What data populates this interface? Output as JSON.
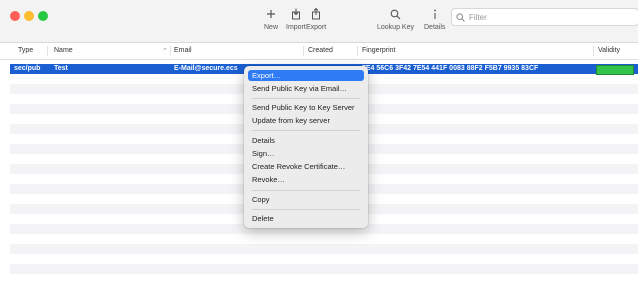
{
  "toolbar": {
    "new_label": "New",
    "import_label": "Import",
    "export_label": "Export",
    "lookup_label": "Lookup Key",
    "details_label": "Details",
    "search_placeholder": "Filter"
  },
  "table": {
    "columns": [
      "Type",
      "Name",
      "Email",
      "Created",
      "Fingerprint",
      "Validity"
    ],
    "selected_row": {
      "type": "sec/pub",
      "name": "Test",
      "email": "E-Mail@secure.ecs",
      "fingerprint": "7E4 56C6 3F42 7E54 441F  0083 88F2 F5B7 9935 83CF"
    }
  },
  "context_menu": {
    "items": [
      "Export…",
      "Send Public Key via Email…",
      "Send Public Key to Key Server",
      "Update from key server",
      "Details",
      "Sign…",
      "Create Revoke Certificate…",
      "Revoke…",
      "Copy",
      "Delete"
    ]
  },
  "colors": {
    "selection": "#1a5fd1",
    "menu_highlight": "#2f7bf6",
    "validity": "#33c24a"
  }
}
